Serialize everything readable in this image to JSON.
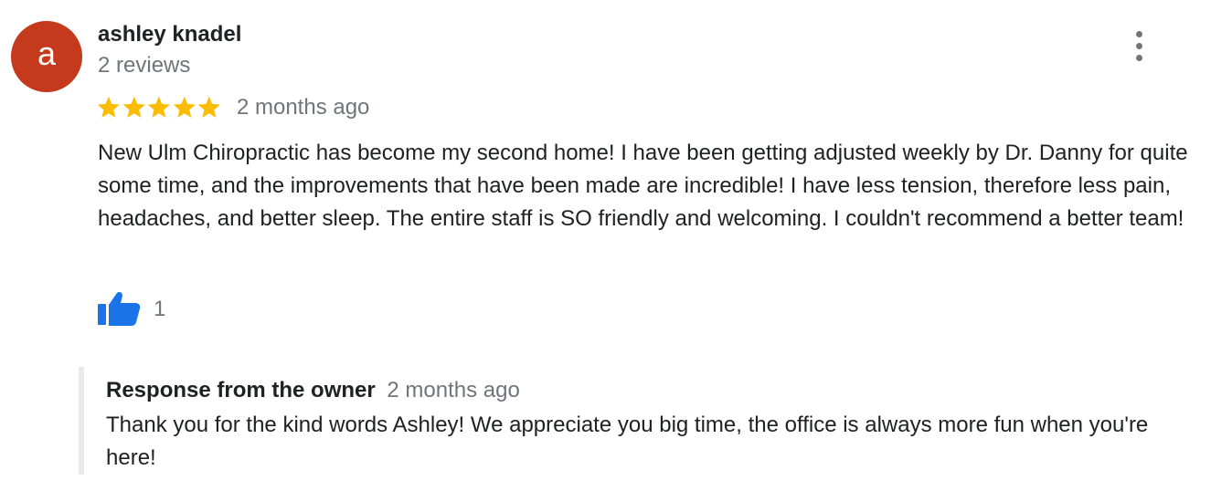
{
  "review": {
    "avatar_letter": "a",
    "avatar_color": "#c5391c",
    "author_name": "ashley knadel",
    "review_count": "2 reviews",
    "rating": 5,
    "rating_max": 5,
    "star_color": "#fbbc04",
    "time_ago": "2 months ago",
    "text": "New Ulm Chiropractic has become my second home! I have been getting adjusted weekly by Dr. Danny for quite some time, and the improvements that have been made are incredible! I have less tension, therefore less pain, headaches, and better sleep. The entire staff is SO friendly and welcoming. I couldn't recommend a better team!",
    "like_count": "1",
    "like_icon": "thumbs-up-icon",
    "like_color": "#1a73e8",
    "more_icon": "more-vert-icon"
  },
  "owner_response": {
    "label": "Response from the owner",
    "time_ago": "2 months ago",
    "text": "Thank you for the kind words Ashley! We appreciate you big time, the office is always more fun when you're here!"
  }
}
